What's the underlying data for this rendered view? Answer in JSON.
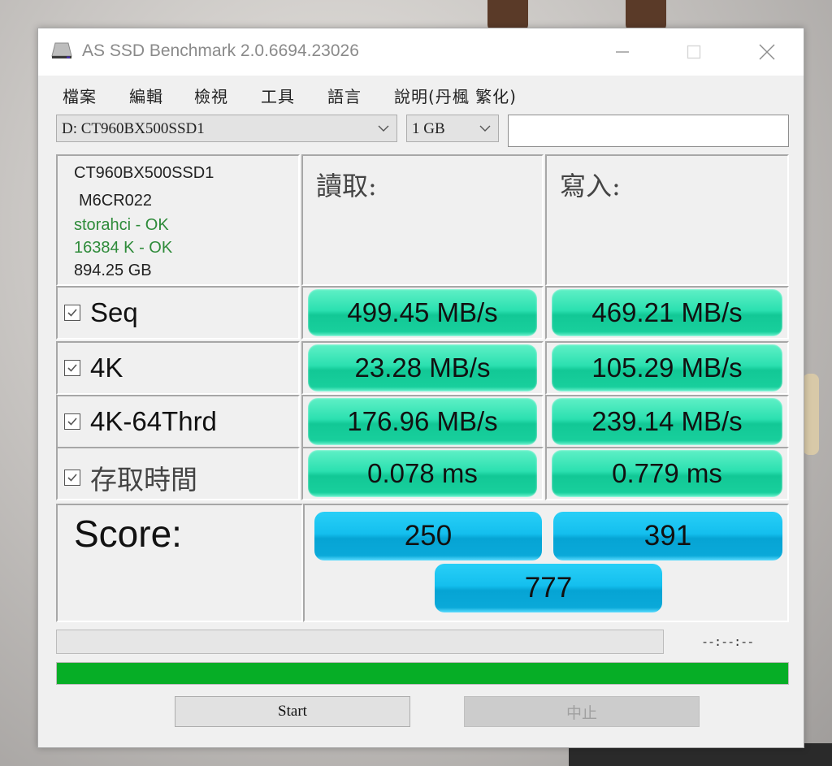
{
  "window": {
    "title": "AS SSD Benchmark 2.0.6694.23026",
    "controls": {
      "minimize": "minimize",
      "maximize": "maximize",
      "close": "close"
    }
  },
  "menu": [
    "檔案",
    "編輯",
    "檢視",
    "工具",
    "語言",
    "說明(丹楓 繁化)"
  ],
  "toolbar": {
    "drive_selected": "D: CT960BX500SSD1",
    "size_selected": "1 GB",
    "textbox_value": ""
  },
  "drive_info": {
    "model": "CT960BX500SSD1",
    "firmware": "M6CR022",
    "driver_status": "storahci - OK",
    "alignment_status": "16384 K - OK",
    "capacity": "894.25 GB"
  },
  "columns": {
    "read": "讀取:",
    "write": "寫入:"
  },
  "tests": [
    {
      "label": "Seq",
      "checked": true,
      "read": "499.45 MB/s",
      "write": "469.21 MB/s"
    },
    {
      "label": "4K",
      "checked": true,
      "read": "23.28 MB/s",
      "write": "105.29 MB/s"
    },
    {
      "label": "4K-64Thrd",
      "checked": true,
      "read": "176.96 MB/s",
      "write": "239.14 MB/s"
    },
    {
      "label": "存取時間",
      "checked": true,
      "read": "0.078 ms",
      "write": "0.779 ms"
    }
  ],
  "score": {
    "label": "Score:",
    "read": "250",
    "write": "391",
    "total": "777"
  },
  "progress": {
    "time_readout": "--:--:--",
    "main_progress_percent": 100
  },
  "buttons": {
    "start": "Start",
    "stop": "中止"
  },
  "colors": {
    "result_pill": "#2be0b0",
    "score_pill": "#14bfee",
    "progress_green": "#06ae26",
    "ok_green": "#2e8b3a"
  }
}
